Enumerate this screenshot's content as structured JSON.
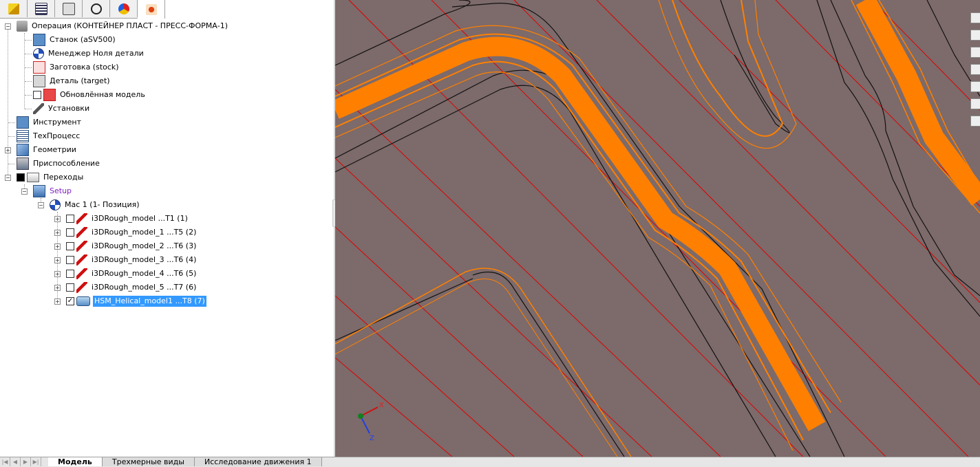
{
  "tabs": [
    {
      "icon": "part-cube-icon"
    },
    {
      "icon": "property-list-icon"
    },
    {
      "icon": "config-tree-icon"
    },
    {
      "icon": "crosshair-icon"
    },
    {
      "icon": "appearance-sphere-icon"
    },
    {
      "icon": "cam-manager-icon",
      "active": true
    }
  ],
  "tree": {
    "operation": "Операция (КОНТЕЙНЕР ПЛАСТ - ПРЕСС-ФОРМА-1)",
    "machine": "Станок (aSV500)",
    "part_zero": "Менеджер Ноля детали",
    "stock": "Заготовка (stock)",
    "target": "Деталь (target)",
    "updated_model": "Обновлённая модель",
    "setups": "Установки",
    "tool": "Инструмент",
    "techprocess": "ТехПроцесс",
    "geometries": "Геометрии",
    "fixture": "Приспособление",
    "transitions": "Переходы",
    "setup": "Setup",
    "mac1": "Mac 1 (1- Позиция)",
    "ops": [
      {
        "label": "i3DRough_model ...T1 (1)",
        "checked": false
      },
      {
        "label": "i3DRough_model_1 ...T5 (2)",
        "checked": false
      },
      {
        "label": "i3DRough_model_2 ...T6 (3)",
        "checked": false
      },
      {
        "label": "i3DRough_model_3 ...T6 (4)",
        "checked": false
      },
      {
        "label": "i3DRough_model_4 ...T6 (5)",
        "checked": false
      },
      {
        "label": "i3DRough_model_5 ...T7 (6)",
        "checked": false
      },
      {
        "label": "HSM_Helical_model1 ...T8 (7)",
        "checked": true,
        "selected": true
      }
    ]
  },
  "viewport": {
    "background": "#7d6a6a",
    "toolpath_color": "#ff8000",
    "axis_x": "X",
    "axis_z": "Z"
  },
  "bottom_tabs": [
    {
      "label": "Модель",
      "active": true
    },
    {
      "label": "Трехмерные виды",
      "active": false
    },
    {
      "label": "Исследование движения 1",
      "active": false
    }
  ]
}
